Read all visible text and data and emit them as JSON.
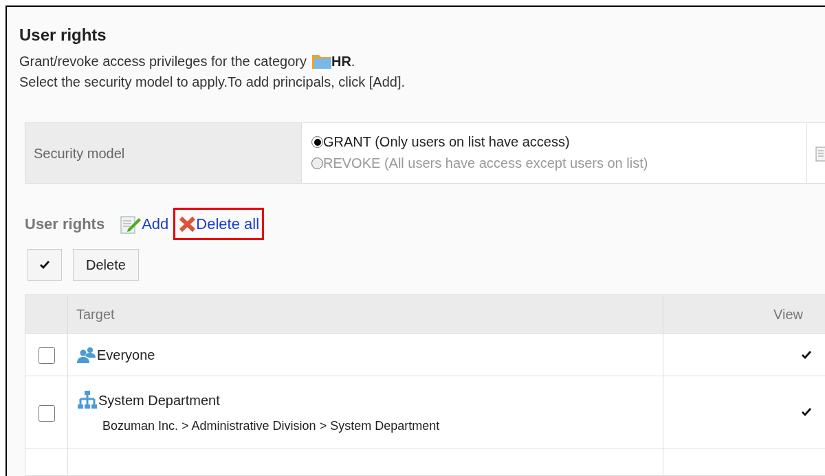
{
  "title": "User rights",
  "description": {
    "line_1_before": "Grant/revoke access privileges for the category",
    "category": "HR",
    "line_1_after": ".",
    "line_2": "Select the security model to apply.To add principals, click [Add]."
  },
  "security_model": {
    "label": "Security model",
    "options": [
      {
        "label": "GRANT (Only users on list have access)",
        "selected": true
      },
      {
        "label": "REVOKE (All users have access except users on list)",
        "selected": false
      }
    ]
  },
  "user_rights": {
    "heading": "User rights",
    "actions": [
      {
        "kind": "add",
        "label": "Add",
        "highlighted": false
      },
      {
        "kind": "delete",
        "label": "Delete all",
        "highlighted": true
      }
    ]
  },
  "delete_button": "Delete",
  "table": {
    "columns": [
      "Target",
      "View"
    ],
    "rows": [
      {
        "kind": "group",
        "name": "Everyone",
        "path": null,
        "checked": false,
        "view": true
      },
      {
        "kind": "department",
        "name": "System Department",
        "path": "Bozuman Inc. > Administrative Division > System Department",
        "checked": false,
        "view": true
      }
    ]
  }
}
